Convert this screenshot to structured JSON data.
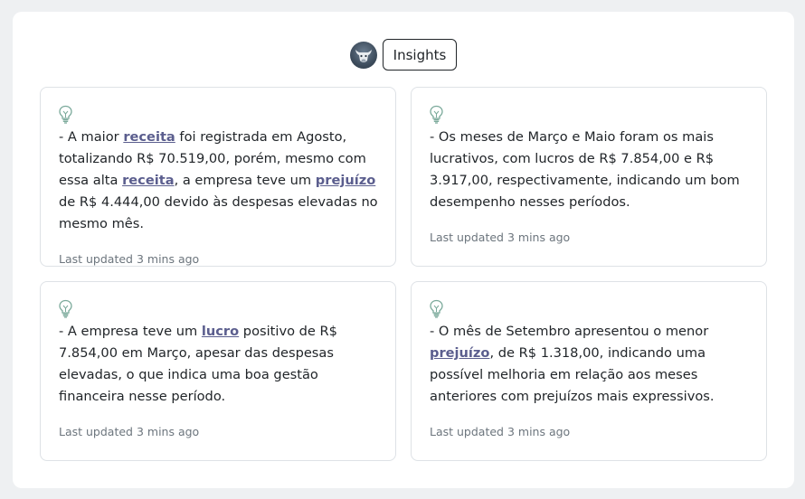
{
  "header": {
    "badge_label": "Insights",
    "avatar_icon": "bull-avatar-icon"
  },
  "accent_color": "#5b5e8e",
  "cards": [
    {
      "icon": "lightbulb-icon",
      "segments": [
        "- A maior ",
        "receita",
        " foi registrada em Agosto, totalizando R$ 70.519,00, porém, mesmo com essa alta ",
        "receita",
        ", a empresa teve um ",
        "prejuízo",
        " de R$ 4.444,00 devido às despesas elevadas no mesmo mês."
      ],
      "updated": "Last updated 3 mins ago"
    },
    {
      "icon": "lightbulb-icon",
      "segments": [
        "- Os meses de Março e Maio foram os mais lucrativos, com lucros de R$ 7.854,00 e R$ 3.917,00, respectivamente, indicando um bom desempenho nesses períodos."
      ],
      "updated": "Last updated 3 mins ago"
    },
    {
      "icon": "lightbulb-icon",
      "segments": [
        "- A empresa teve um ",
        "lucro",
        " positivo de R$ 7.854,00 em Março, apesar das despesas elevadas, o que indica uma boa gestão financeira nesse período."
      ],
      "updated": "Last updated 3 mins ago"
    },
    {
      "icon": "lightbulb-icon",
      "segments": [
        "- O mês de Setembro apresentou o menor ",
        "prejuízo",
        ", de R$ 1.318,00, indicando uma possível melhoria em relação aos meses anteriores com prejuízos mais expressivos."
      ],
      "updated": "Last updated 3 mins ago"
    }
  ]
}
